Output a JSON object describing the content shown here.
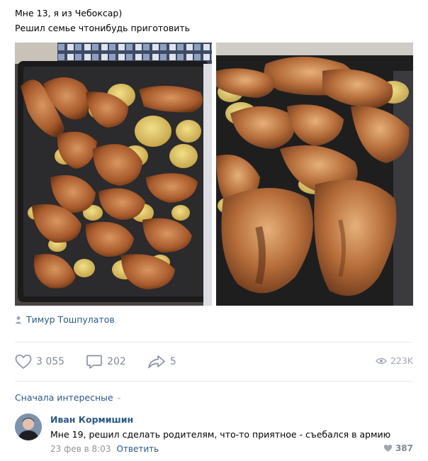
{
  "post": {
    "lines": [
      "Мне 13, я из Чебоксар)",
      "Решил семье чтонибудь приготовить"
    ],
    "author": "Тимур Тошпулатов",
    "photos": [
      {
        "name": "photo-baked-chicken-wings-potatoes-tray"
      },
      {
        "name": "photo-baked-chicken-wings-closeup"
      }
    ]
  },
  "actions": {
    "likes": "3 055",
    "comments": "202",
    "shares": "5",
    "views": "223K"
  },
  "icons": {
    "like": "heart-icon",
    "comment": "comment-bubble-icon",
    "share": "share-arrow-icon",
    "views": "eye-icon",
    "author": "person-icon"
  },
  "comments": {
    "sort_label": "Сначала интересные",
    "items": [
      {
        "author": "Иван Кормишин",
        "text": "Мне 19, решил сделать родителям, что-то приятное - съебался в армию",
        "date": "23 фев в 8:03",
        "reply_label": "Ответить",
        "likes": "387"
      }
    ]
  },
  "colors": {
    "link": "#2a5885",
    "muted": "#828a99",
    "divider": "#e7e8ec"
  }
}
